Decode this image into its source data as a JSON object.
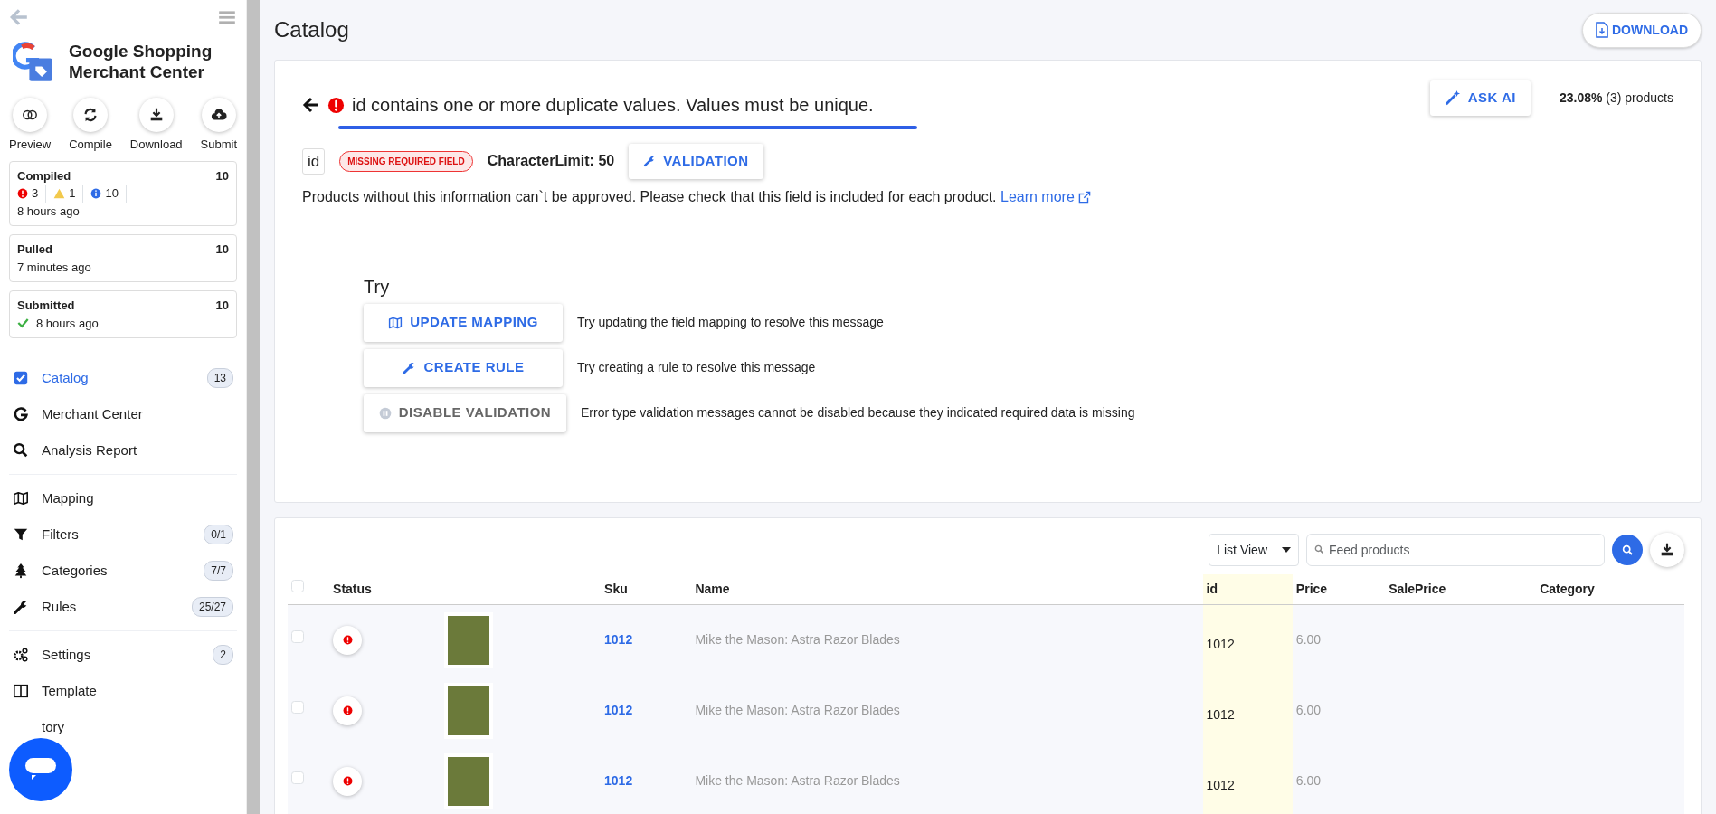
{
  "sidebar": {
    "title_line_1": "Google Shopping",
    "title_line_2": "Merchant Center",
    "actions": [
      {
        "label": "Preview"
      },
      {
        "label": "Compile"
      },
      {
        "label": "Download"
      },
      {
        "label": "Submit"
      }
    ],
    "status_cards": [
      {
        "kind": "compiled",
        "title": "Compiled",
        "count": "10",
        "errors": "3",
        "warnings": "1",
        "infos": "10",
        "time": "8 hours ago"
      },
      {
        "kind": "plain",
        "title": "Pulled",
        "count": "10",
        "time": "7 minutes ago"
      },
      {
        "kind": "checked",
        "title": "Submitted",
        "count": "10",
        "time": "8 hours ago"
      }
    ],
    "nav_groups": [
      [
        {
          "label": "Catalog",
          "badge": "13",
          "selected": true
        },
        {
          "label": "Merchant Center",
          "selected": false
        },
        {
          "label": "Analysis Report",
          "selected": false
        }
      ],
      [
        {
          "label": "Mapping",
          "selected": false
        },
        {
          "label": "Filters",
          "badge": "0/1",
          "selected": false
        },
        {
          "label": "Categories",
          "badge": "7/7",
          "selected": false
        },
        {
          "label": "Rules",
          "badge": "25/27",
          "selected": false
        }
      ],
      [
        {
          "label": "Settings",
          "badge": "2",
          "selected": false
        },
        {
          "label": "Template",
          "selected": false
        },
        {
          "label": "tory",
          "selected": false
        }
      ]
    ]
  },
  "header": {
    "title": "Catalog",
    "download_button": "DOWNLOAD"
  },
  "issue": {
    "message": "id contains one or more duplicate values. Values must be unique.",
    "ask_ai_button": "ASK AI",
    "share": "**23.08%** (3) products",
    "field": "id",
    "tag": "MISSING REQUIRED FIELD",
    "limit": "CharacterLimit: 50",
    "validation_button": "VALIDATION",
    "description": "Products without this information can`t be approved. Please check that this field is included for each product.",
    "learn_more": "Learn more"
  },
  "try": {
    "heading": "Try",
    "actions": [
      {
        "label": "UPDATE MAPPING",
        "hint": "Try updating the field mapping to resolve this message",
        "disabled": false
      },
      {
        "label": "CREATE RULE",
        "hint": "Try creating a rule to resolve this message",
        "disabled": false
      },
      {
        "label": "DISABLE VALIDATION",
        "hint": "Error type validation messages cannot be disabled because they indicated required data is missing",
        "disabled": true
      }
    ]
  },
  "table": {
    "view_select": "List View",
    "search": {
      "placeholder": "Feed products"
    },
    "columns": [
      {
        "label": "Status",
        "highlighted": false
      },
      {
        "highlighted": false
      },
      {
        "label": "Sku",
        "highlighted": false
      },
      {
        "label": "Name",
        "highlighted": false
      },
      {
        "label": "id",
        "highlighted": true
      },
      {
        "label": "Price",
        "highlighted": false
      },
      {
        "label": "SalePrice",
        "highlighted": false
      },
      {
        "label": "Category",
        "highlighted": false
      }
    ],
    "all_checked": false,
    "rows": [
      {
        "checked": false,
        "sku": "1012",
        "name": "Mike the Mason: Astra Razor Blades",
        "id": "1012",
        "price": "6.00"
      },
      {
        "checked": false,
        "sku": "1012",
        "name": "Mike the Mason: Astra Razor Blades",
        "id": "1012",
        "price": "6.00"
      },
      {
        "checked": false,
        "sku": "1012",
        "name": "Mike the Mason: Astra Razor Blades",
        "id": "1012",
        "price": "6.00"
      }
    ]
  }
}
